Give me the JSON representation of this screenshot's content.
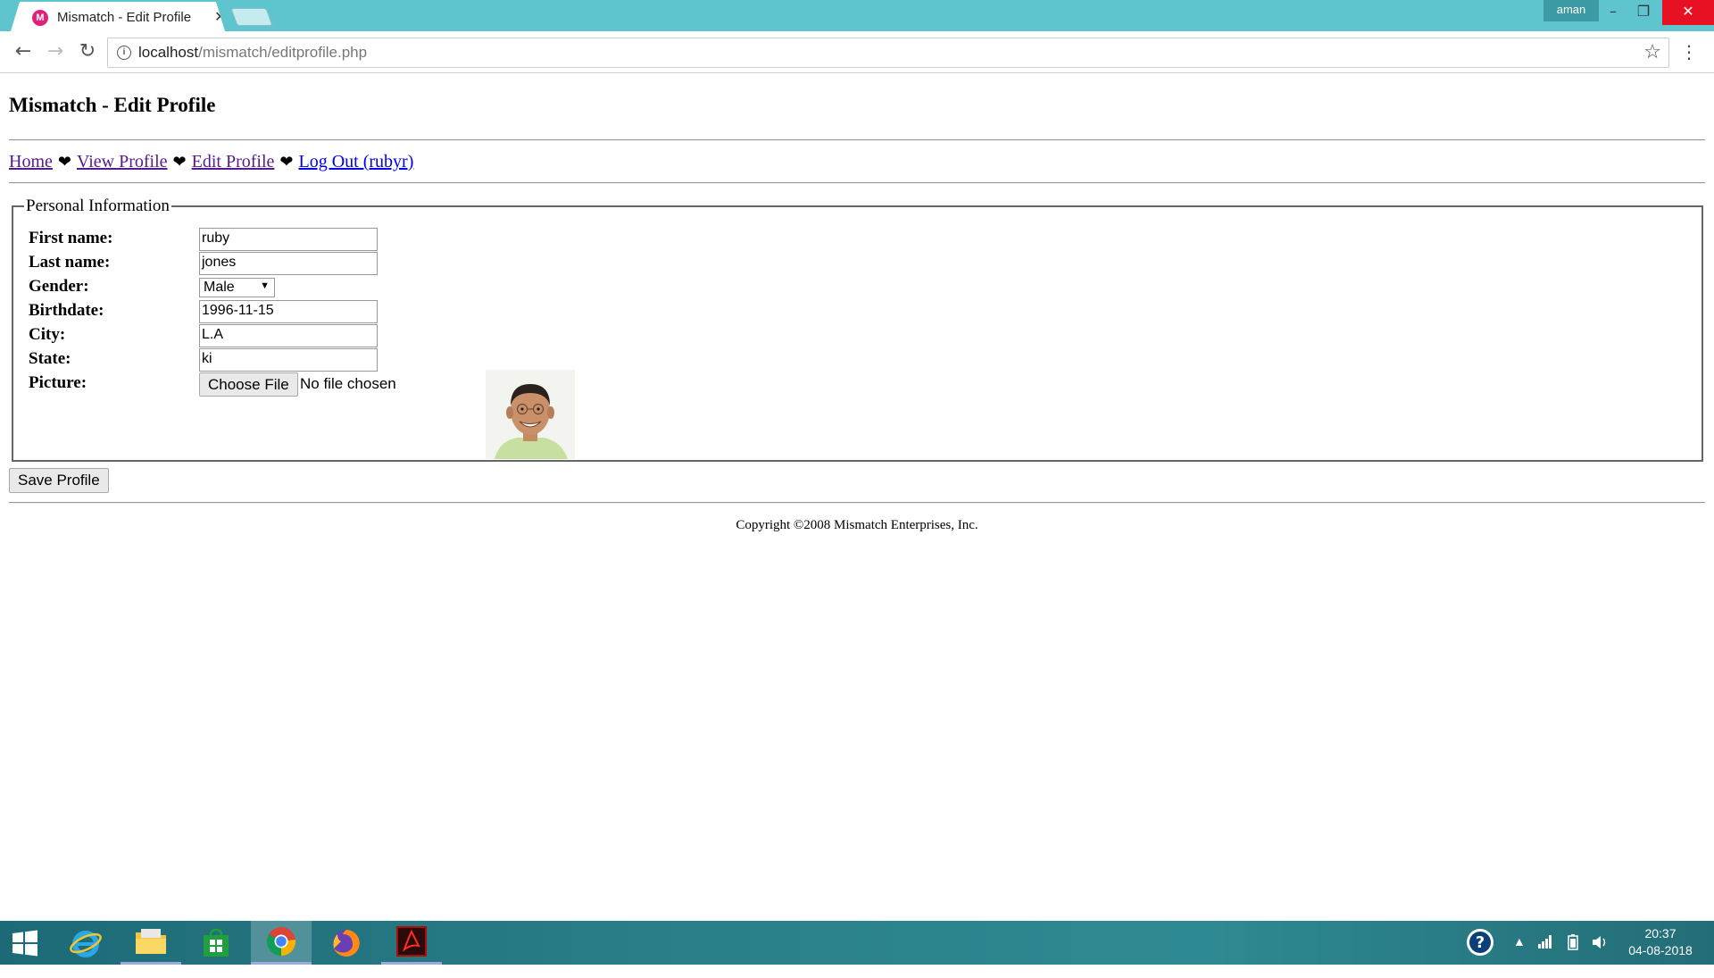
{
  "browser": {
    "tab_title": "Mismatch - Edit Profile",
    "tab_favicon_letter": "M",
    "user_badge": "aman",
    "url_host": "localhost",
    "url_path": "/mismatch/editprofile.php"
  },
  "page": {
    "title": "Mismatch - Edit Profile",
    "nav": {
      "home": "Home",
      "view_profile": "View Profile",
      "edit_profile": "Edit Profile",
      "logout": "Log Out (rubyr)",
      "separator": "❤"
    },
    "fieldset_legend": "Personal Information",
    "form": {
      "first_name_label": "First name:",
      "first_name_value": "ruby",
      "last_name_label": "Last name:",
      "last_name_value": "jones",
      "gender_label": "Gender:",
      "gender_value": "Male",
      "birthdate_label": "Birthdate:",
      "birthdate_value": "1996-11-15",
      "city_label": "City:",
      "city_value": "L.A",
      "state_label": "State:",
      "state_value": "ki",
      "picture_label": "Picture:",
      "choose_file_label": "Choose File",
      "file_status": "No file chosen"
    },
    "save_button": "Save Profile",
    "copyright": "Copyright ©2008 Mismatch Enterprises, Inc."
  },
  "taskbar": {
    "apps": [
      "start-icon",
      "internet-explorer-icon",
      "file-explorer-icon",
      "store-icon",
      "chrome-icon",
      "firefox-icon",
      "acrobat-icon"
    ],
    "time": "20:37",
    "date": "04-08-2018"
  },
  "colors": {
    "titlebar": "#5ec5cf",
    "close_button": "#e81123",
    "visited_link": "#551a8b",
    "link": "#0000ee"
  }
}
